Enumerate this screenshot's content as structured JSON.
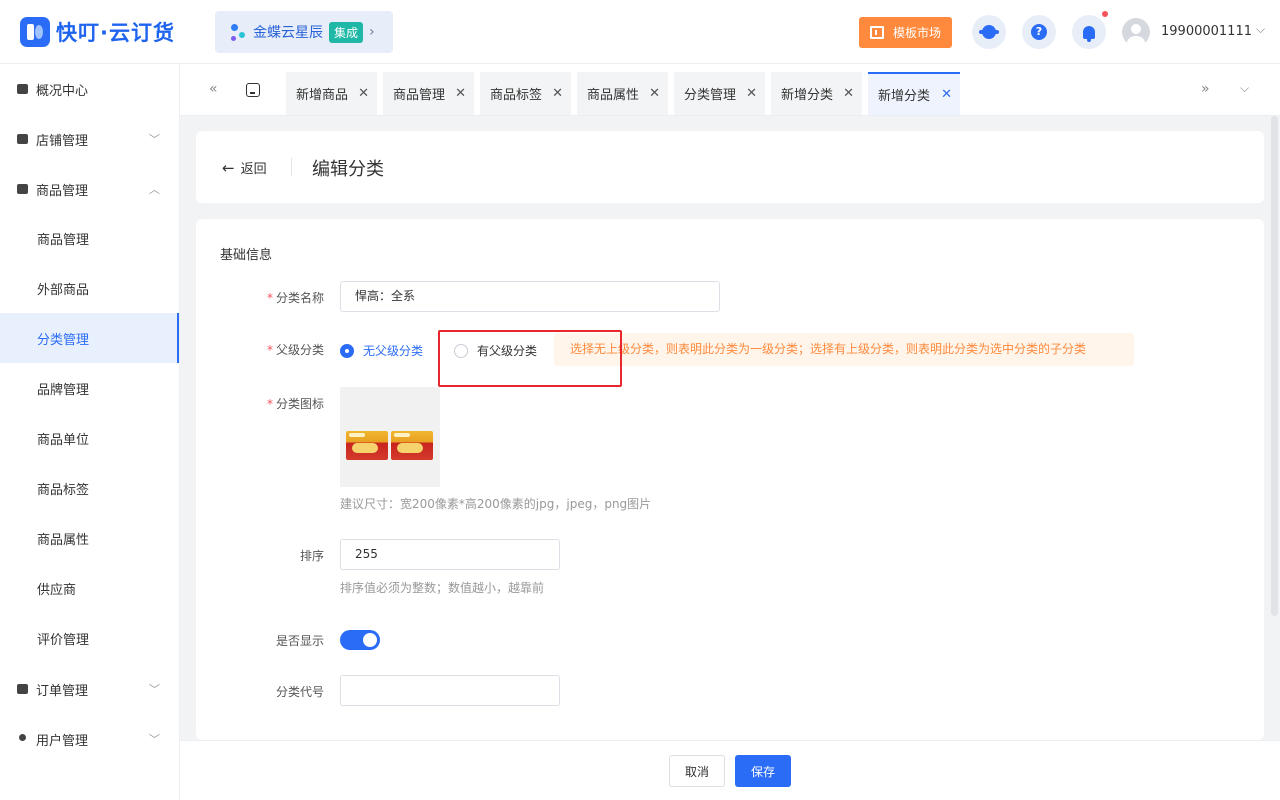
{
  "header": {
    "app_title": "快叮·云订货",
    "integration": {
      "name": "金蝶云星辰",
      "badge": "集成"
    },
    "template_market": "模板市场",
    "user": "19900001111",
    "accent_color": "#2b6cf6"
  },
  "sidebar": {
    "items": [
      {
        "label": "概况中心"
      },
      {
        "label": "店铺管理"
      },
      {
        "label": "商品管理"
      },
      {
        "label": "订单管理"
      },
      {
        "label": "用户管理"
      }
    ],
    "sub_items": [
      {
        "label": "商品管理"
      },
      {
        "label": "外部商品"
      },
      {
        "label": "分类管理"
      },
      {
        "label": "品牌管理"
      },
      {
        "label": "商品单位"
      },
      {
        "label": "商品标签"
      },
      {
        "label": "商品属性"
      },
      {
        "label": "供应商"
      },
      {
        "label": "评价管理"
      }
    ],
    "active_sub": "分类管理"
  },
  "tabs": [
    {
      "label": "新增商品"
    },
    {
      "label": "商品管理"
    },
    {
      "label": "商品标签"
    },
    {
      "label": "商品属性"
    },
    {
      "label": "分类管理"
    },
    {
      "label": "新增分类"
    },
    {
      "label": "新增分类"
    }
  ],
  "page": {
    "back_label": "返回",
    "title": "编辑分类"
  },
  "form": {
    "section_title": "基础信息",
    "name_label": "分类名称",
    "name_value": "悍高：全系",
    "parent_label": "父级分类",
    "radio_none": "无父级分类",
    "radio_has": "有父级分类",
    "parent_hint": "选择无上级分类，则表明此分类为一级分类；选择有上级分类，则表明此分类为选中分类的子分类",
    "icon_label": "分类图标",
    "icon_hint": "建议尺寸：宽200像素*高200像素的jpg，jpeg，png图片",
    "sort_label": "排序",
    "sort_value": "255",
    "sort_hint": "排序值必须为整数；数值越小，越靠前",
    "display_label": "是否显示",
    "display_on": true,
    "code_label": "分类代号",
    "code_value": ""
  },
  "footer": {
    "cancel": "取消",
    "save": "保存"
  }
}
